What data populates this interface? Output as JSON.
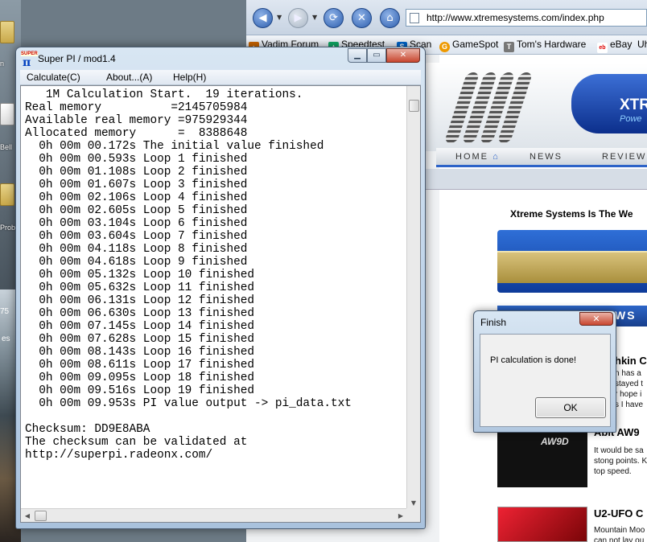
{
  "desktop": {
    "icons": [
      {
        "label": "n"
      },
      {
        "label": "Bell"
      },
      {
        "label": "Prob"
      }
    ],
    "side_labels": [
      "es",
      "75"
    ]
  },
  "browser": {
    "url": "http://www.xtremesystems.com/index.php",
    "bookmarks": [
      "Vadim Forum",
      "Speedtest",
      "Scan",
      "GameSpot",
      "Tom's Hardware",
      "eBay",
      "Uh"
    ],
    "site": {
      "banner_text": "XTR",
      "banner_sub": "Powe",
      "nav": [
        "HOME",
        "NEWS",
        "REVIEWS"
      ],
      "heading": "Xtreme Systems Is The We",
      "dark_bar_text": "WS",
      "articles": [
        {
          "title": "hkin C",
          "lines": [
            "n has a",
            "stayed t",
            "r hope i",
            "s I have"
          ]
        },
        {
          "title": "Abit AW9",
          "lines": [
            "It would be sa",
            "stong points. K",
            "top speed."
          ]
        },
        {
          "title": "U2-UFO C",
          "lines": [
            "Mountain Moo",
            "can not lay ou"
          ]
        }
      ]
    }
  },
  "superpi": {
    "title": "Super PI / mod1.4",
    "menu": [
      "Calculate(C)",
      "About...(A)",
      "Help(H)"
    ],
    "log_lines": [
      "   1M Calculation Start.  19 iterations.",
      "Real memory          =2145705984",
      "Available real memory =975929344",
      "Allocated memory      =  8388648",
      "  0h 00m 00.172s The initial value finished",
      "  0h 00m 00.593s Loop 1 finished",
      "  0h 00m 01.108s Loop 2 finished",
      "  0h 00m 01.607s Loop 3 finished",
      "  0h 00m 02.106s Loop 4 finished",
      "  0h 00m 02.605s Loop 5 finished",
      "  0h 00m 03.104s Loop 6 finished",
      "  0h 00m 03.604s Loop 7 finished",
      "  0h 00m 04.118s Loop 8 finished",
      "  0h 00m 04.618s Loop 9 finished",
      "  0h 00m 05.132s Loop 10 finished",
      "  0h 00m 05.632s Loop 11 finished",
      "  0h 00m 06.131s Loop 12 finished",
      "  0h 00m 06.630s Loop 13 finished",
      "  0h 00m 07.145s Loop 14 finished",
      "  0h 00m 07.628s Loop 15 finished",
      "  0h 00m 08.143s Loop 16 finished",
      "  0h 00m 08.611s Loop 17 finished",
      "  0h 00m 09.095s Loop 18 finished",
      "  0h 00m 09.516s Loop 19 finished",
      "  0h 00m 09.953s PI value output -> pi_data.txt",
      "",
      "Checksum: DD9E8ABA",
      "The checksum can be validated at",
      "http://superpi.radeonx.com/"
    ]
  },
  "finish_dialog": {
    "title": "Finish",
    "message": "PI calculation is done!",
    "ok_label": "OK"
  },
  "colors": {
    "window_frame": "#b9cfe6",
    "close_button": "#c8462f",
    "site_blue": "#2d63c8"
  }
}
